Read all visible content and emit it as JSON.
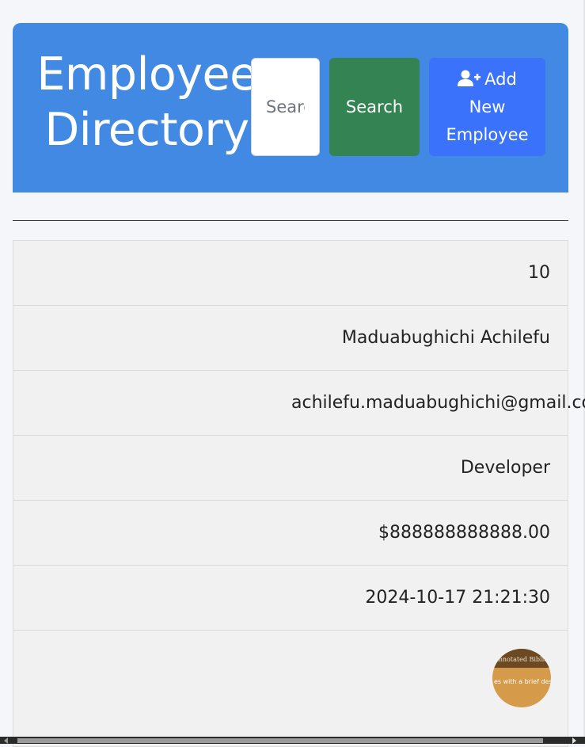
{
  "header": {
    "title_line1": "Employee",
    "title_line2": "Directory",
    "search_placeholder": "Search",
    "search_value": "",
    "search_button": "Search",
    "add_button_line1": "Add",
    "add_button_line2": "New",
    "add_button_line3": "Employee",
    "add_icon": "user-plus-icon"
  },
  "employee": {
    "id": "10",
    "name": "Maduabughichi Achilefu",
    "email": "achilefu.maduabughichi@gmail.com",
    "position": "Developer",
    "salary": "$888888888888.00",
    "created_at": "2024-10-17 21:21:30"
  },
  "floating_badge": {
    "line1": "Annotated Bibliography",
    "line2": "es with a brief desc"
  },
  "colors": {
    "header_bg": "#4289e4",
    "search_button": "#348453",
    "add_button": "#3a72fb"
  }
}
